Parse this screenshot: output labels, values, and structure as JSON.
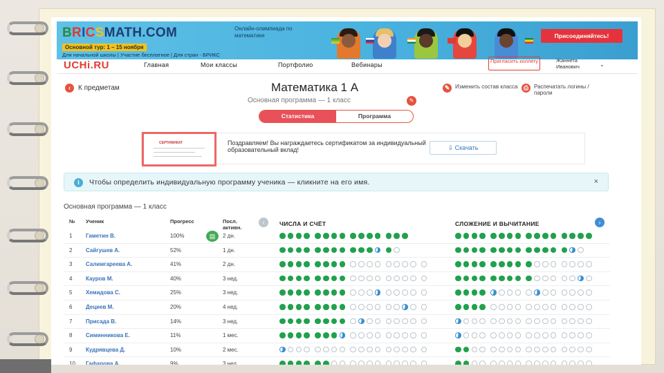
{
  "banner": {
    "brand": [
      "BRICS",
      "MATH",
      ".COM"
    ],
    "tagline": "Онлайн-олимпиада по математике",
    "round": "Основной тур: 1 – 15 ноября",
    "round_sub": "Для начальной школы | Участие бесплатное | Для стран - БРИКС",
    "join_label": "Присоединяйтесь!"
  },
  "nav": {
    "logo": "UCHi.RU",
    "items": [
      "Главная",
      "Мои классы",
      "Портфолио",
      "Вебинары"
    ],
    "invite": "Пригласить коллегу",
    "user_first": "Жаннета",
    "user_last": "Иванович"
  },
  "page": {
    "back_label": "К предметам",
    "title": "Математика 1 А",
    "subtitle": "Основная программа — 1 класс",
    "action_edit": "Изменить состав класса",
    "action_print": "Распечатать логины / пароли",
    "tabs": [
      "Статистика",
      "Программа"
    ]
  },
  "certificate": {
    "image_title": "СЕРТИФИКАТ",
    "text": "Поздравляем! Вы награждаетесь сертификатом за индивидуальный образовательный вклад!",
    "download_label": "Скачать"
  },
  "info": {
    "icon": "i",
    "text": "Чтобы определить индивидуальную программу ученика — кликните на его имя.",
    "close": "×"
  },
  "table": {
    "heading": "Основная программа — 1 класс",
    "headers": {
      "num": "№",
      "student": "Ученик",
      "progress": "Прогресс",
      "last": "Посл. активн."
    },
    "section1": "ЧИСЛА И СЧЁТ",
    "section2": "СЛОЖЕНИЕ И ВЫЧИТАНИЕ",
    "rows": [
      {
        "num": "1",
        "name": "Гаметин В.",
        "progress": "100%",
        "last": "2 дн.",
        "g1": "FFFFFFFFFFFFFFF",
        "g2": "FFFFFFFFFFFFFFFF"
      },
      {
        "num": "2",
        "name": "Сайгушев А.",
        "progress": "52%",
        "last": "1 дн.",
        "g1": "FFFFFFFFFFFHFE",
        "g2": "FFFFFFFFFFFFFHE"
      },
      {
        "num": "3",
        "name": "Салимгареева А.",
        "progress": "41%",
        "last": "2 дн.",
        "g1": "FFFFFFFFEEEEEEEEE",
        "g2": "FFFFFFFFFEEEEEEE"
      },
      {
        "num": "4",
        "name": "Кауров М.",
        "progress": "40%",
        "last": "3 нед.",
        "g1": "FFFFFFFFEEEEEEEEE",
        "g2": "FFFFFFFFFEEEEEHE"
      },
      {
        "num": "5",
        "name": "Хемидова С.",
        "progress": "25%",
        "last": "3 нед.",
        "g1": "FFFFFFFFEEEHEEEEE",
        "g2": "FFFFHEEEEHEEEEEE"
      },
      {
        "num": "6",
        "name": "Дециев М.",
        "progress": "20%",
        "last": "4 нед.",
        "g1": "FFFFFFFFEEEEEEHEE",
        "g2": "FFFFEEEEEEEEEEEE"
      },
      {
        "num": "7",
        "name": "Присада В.",
        "progress": "14%",
        "last": "3 нед.",
        "g1": "FFFFFFFFEHEEEEEEE",
        "g2": "HEEEEEEEEEEEEEEE"
      },
      {
        "num": "8",
        "name": "Симинникова Е.",
        "progress": "11%",
        "last": "1 мес.",
        "g1": "FFFFFFFHEEEEEEEEE",
        "g2": "HEEEEEEEEEEEEEEE"
      },
      {
        "num": "9",
        "name": "Кудрявцева Д.",
        "progress": "10%",
        "last": "2 мес.",
        "g1": "HEEEEEEEEEEEEEEEE",
        "g2": "FFEEEEEEEEEEEEEE"
      },
      {
        "num": "10",
        "name": "Гафарова А.",
        "progress": "9%",
        "last": "3 нед.",
        "g1": "FFFFFFEEEEEEEEEEE",
        "g2": "FFEEEEEEEEEEEEEE"
      }
    ]
  },
  "colors": {
    "accent": "#e5533f",
    "done": "#21a14d",
    "partial": "#3a8fd0",
    "link": "#3b73b9"
  }
}
